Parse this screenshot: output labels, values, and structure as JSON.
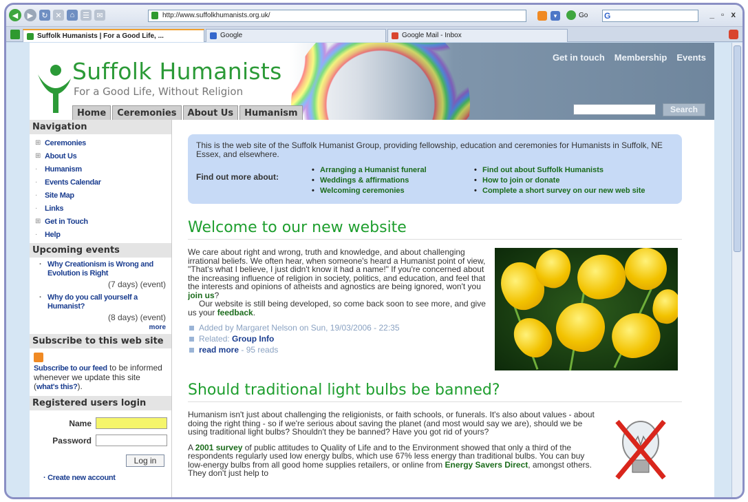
{
  "browser": {
    "url": "http://www.suffolkhumanists.org.uk/",
    "go_label": "Go",
    "google_search_logo": "G",
    "window_controls": [
      "_",
      "▫",
      "x"
    ],
    "tabs": [
      {
        "label": "Suffolk Humanists | For a Good Life, ..."
      },
      {
        "label": "Google"
      },
      {
        "label": "Google Mail - Inbox"
      }
    ]
  },
  "header": {
    "title": "Suffolk Humanists",
    "tagline": "For a Good Life, Without Religion",
    "top_links": [
      "Get in touch",
      "Membership",
      "Events"
    ],
    "main_tabs": [
      "Home",
      "Ceremonies",
      "About Us",
      "Humanism"
    ],
    "search_button": "Search"
  },
  "sidebar": {
    "navigation_title": "Navigation",
    "nav_items": [
      {
        "bullet": "⊞",
        "label": "Ceremonies"
      },
      {
        "bullet": "⊞",
        "label": "About Us"
      },
      {
        "bullet": "·",
        "label": "Humanism"
      },
      {
        "bullet": "·",
        "label": "Events Calendar"
      },
      {
        "bullet": "·",
        "label": "Site Map"
      },
      {
        "bullet": "·",
        "label": "Links"
      },
      {
        "bullet": "⊞",
        "label": "Get in Touch"
      },
      {
        "bullet": "·",
        "label": "Help"
      }
    ],
    "events_title": "Upcoming events",
    "events": [
      {
        "title": "Why Creationism is Wrong and Evolution is Right",
        "meta": "(7 days) (event)"
      },
      {
        "title": "Why do you call yourself a Humanist?",
        "meta": "(8 days) (event)"
      }
    ],
    "more_label": "more",
    "subscribe_title": "Subscribe to this web site",
    "subscribe_link": "Subscribe to our feed",
    "subscribe_text1": " to be informed whenever we update this site (",
    "subscribe_whats": "what's this?",
    "subscribe_text2": ").",
    "login_title": "Registered users login",
    "name_label": "Name",
    "password_label": "Password",
    "login_button": "Log in",
    "create_account": "Create new account"
  },
  "intro": {
    "text": "This is the web site of the Suffolk Humanist Group, providing fellowship, education and ceremonies for Humanists in Suffolk, NE Essex, and elsewhere.",
    "find_out_more": "Find out more about:",
    "col1": [
      "Arranging a Humanist funeral",
      "Weddings & affirmations",
      "Welcoming ceremonies"
    ],
    "col2": [
      "Find out about Suffolk Humanists",
      "How to join or donate",
      "Complete a short survey on our new web site"
    ]
  },
  "article1": {
    "title": "Welcome to our new website",
    "para1": "We care about right and wrong, truth and knowledge, and about challenging irrational beliefs. We often hear, when someone's heard a Humanist point of view, \"That's what I believe, I just didn't know it had a name!\" If you're concerned about the increasing influence of religion in society, politics, and education, and feel that the interests and opinions of atheists and agnostics are being ignored, won't you ",
    "join_link": "join us",
    "para1_end": "?",
    "para2": "Our website is still being developed, so come back soon to see more, and give us your ",
    "feedback_link": "feedback",
    "para2_end": ".",
    "added_by": "Added by Margaret Nelson on Sun, 19/03/2006 - 22:35",
    "related_label": "Related: ",
    "related_value": "Group Info",
    "read_more": "read more",
    "reads": " - 95 reads"
  },
  "article2": {
    "title": "Should traditional light bulbs be banned?",
    "para1": "Humanism isn't just about challenging the religionists, or faith schools, or funerals. It's also about values - about doing the right thing - so if we're serious about saving the planet (and most would say we are), should we be using traditional light bulbs? Shouldn't they be banned? Have you got rid of yours?",
    "para2_a": "A ",
    "survey_link": "2001 survey",
    "para2_b": " of public attitudes to Quality of Life and to the Environment showed that only a third of the respondents regularly used low energy bulbs, which use 67% less energy than traditional bulbs. You can buy low-energy bulbs from all good home supplies retailers, or online from ",
    "energy_link": "Energy Savers Direct",
    "para2_c": ", amongst others. They don't just help to"
  },
  "colors": {
    "brand_green": "#2b9a37",
    "link_blue": "#1a3d8f",
    "intro_bg": "#c7daf6"
  }
}
